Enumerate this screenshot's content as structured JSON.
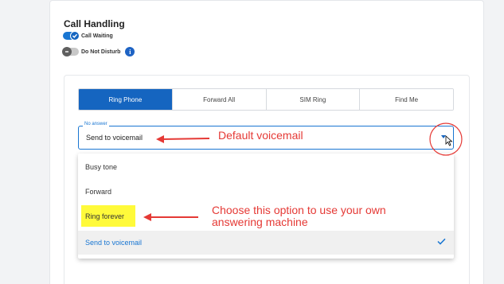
{
  "section": {
    "title": "Call Handling",
    "call_waiting": "Call Waiting",
    "do_not_disturb": "Do Not Disturb",
    "info_glyph": "i"
  },
  "tabs": [
    {
      "label": "Ring Phone",
      "active": true
    },
    {
      "label": "Forward All",
      "active": false
    },
    {
      "label": "SIM Ring",
      "active": false
    },
    {
      "label": "Find Me",
      "active": false
    }
  ],
  "no_answer": {
    "legend": "No answer",
    "value": "Send to voicemail"
  },
  "menu": {
    "items": [
      "Busy tone",
      "Forward",
      "Ring forever",
      "Send to voicemail"
    ],
    "selected": "Send to voicemail"
  },
  "annotations": {
    "default_voicemail": "Default voicemail",
    "choose_option": "Choose this option to use your own answering machine"
  },
  "colors": {
    "accent": "#1565c0",
    "annotation": "#e53935",
    "highlight": "#fffa3a"
  }
}
